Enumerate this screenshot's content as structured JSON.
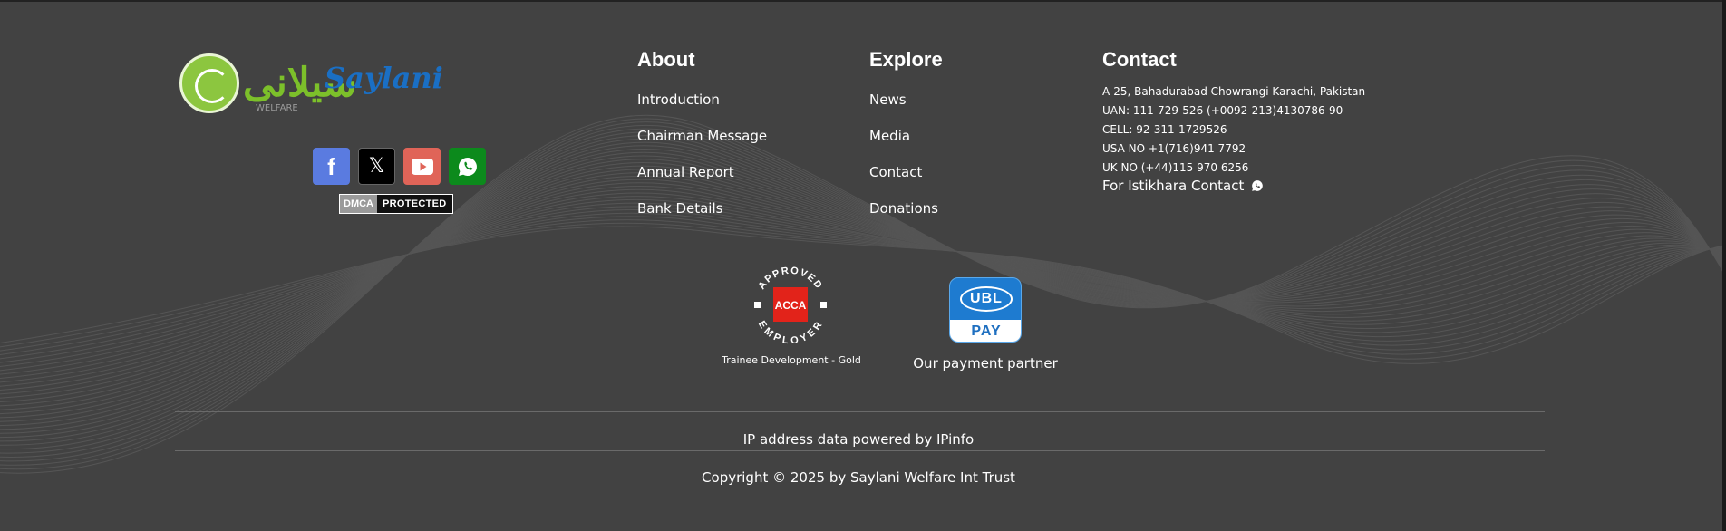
{
  "colors": {
    "background": "#424242",
    "facebook": "#5a7be0",
    "x": "#000000",
    "youtube": "#e06458",
    "whatsapp": "#0c8a1c",
    "brand_green": "#7cc02a",
    "brand_blue": "#1a6fc4",
    "ubl_blue": "#1e7bd0",
    "acca_red": "#e2231a"
  },
  "logo": {
    "urdu_text": "سیلانی",
    "english_text": "Saylani",
    "subtitle": "WELFARE"
  },
  "social": [
    {
      "name": "facebook",
      "icon": "facebook-icon"
    },
    {
      "name": "x",
      "icon": "x-icon",
      "glyph": "𝕏"
    },
    {
      "name": "youtube",
      "icon": "youtube-icon"
    },
    {
      "name": "whatsapp",
      "icon": "whatsapp-icon"
    }
  ],
  "dmca": {
    "left": "DMCA",
    "right": "PROTECTED"
  },
  "about": {
    "heading": "About",
    "links": [
      "Introduction",
      "Chairman Message",
      "Annual Report",
      "Bank Details"
    ]
  },
  "explore": {
    "heading": "Explore",
    "links": [
      "News",
      "Media",
      "Contact",
      "Donations"
    ]
  },
  "contact": {
    "heading": "Contact",
    "lines": [
      "A-25, Bahadurabad Chowrangi Karachi, Pakistan",
      "UAN: 111-729-526 (+0092-213)4130786-90",
      "CELL: 92-311-1729526",
      "USA NO +1(716)941 7792",
      "UK NO (+44)115 970 6256"
    ],
    "istikhara": "For Istikhara Contact",
    "istikhara_icon": "whatsapp-icon"
  },
  "badges": {
    "acca": {
      "top_text": "APPROVED",
      "bottom_text": "EMPLOYER",
      "center_text": "ACCA",
      "caption": "Trainee Development - Gold"
    },
    "ubl": {
      "logo_text": "UBL",
      "pay_text": "PAY",
      "caption": "Our payment partner"
    }
  },
  "footer": {
    "ipinfo": "IP address data powered by IPinfo",
    "copyright": "Copyright © 2025 by Saylani Welfare Int Trust"
  }
}
